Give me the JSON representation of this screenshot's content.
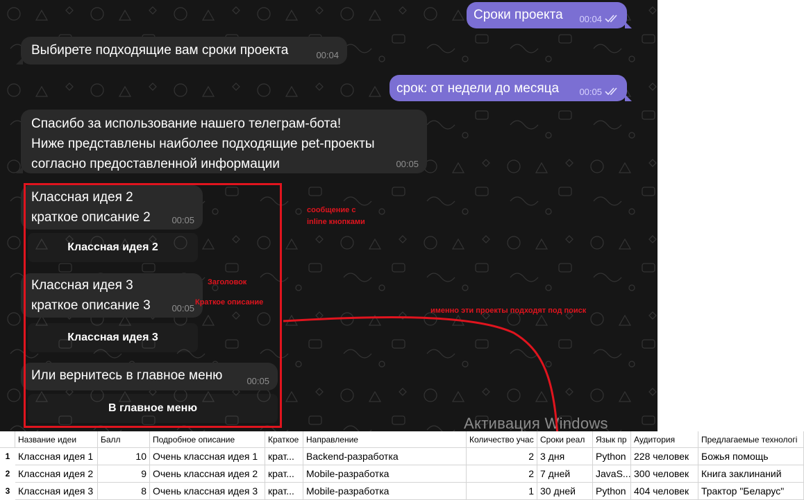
{
  "chat": {
    "messages": {
      "m1": {
        "text": "Сроки проекта",
        "time": "00:04"
      },
      "m2": {
        "text": "Выбирете подходящие вам сроки проекта",
        "time": "00:04"
      },
      "m3": {
        "text": "срок: от недели до месяца",
        "time": "00:05"
      },
      "m4": {
        "line1": "Спасибо за использование нашего телеграм-бота!",
        "line2": "Ниже представлены наиболее подходящие pet-проекты",
        "line3": "согласно предоставленной информации",
        "time": "00:05"
      },
      "m5": {
        "line1": "Классная идея 2",
        "line2": "краткое описание 2",
        "time": "00:05",
        "button": "Классная идея 2"
      },
      "m6": {
        "line1": "Классная идея 3",
        "line2": "краткое описание 3",
        "time": "00:05",
        "button": "Классная идея 3"
      },
      "m7": {
        "text": "Или вернитесь в главное меню",
        "time": "00:05",
        "button": "В главное меню"
      }
    }
  },
  "annotations": {
    "inline_line1": "сообщение с",
    "inline_line2": "inline кнопками",
    "title": "Заголовок",
    "short_desc": "Краткое описание",
    "projects_match": "именно эти проекты подходят под поиск",
    "color": "#e0141e"
  },
  "watermark": "Активация Windows",
  "table": {
    "headers": [
      "Название идеи",
      "Балл",
      "Подробное описание",
      "Краткое",
      "Направление",
      "Количество учас",
      "Сроки реал",
      "Язык пр",
      "Аудитория",
      "Предлагаемые технологі"
    ],
    "rows": [
      {
        "num": "1",
        "cells": [
          "Классная идея 1",
          "10",
          "Очень классная идея 1",
          "крат...",
          "Backend-разработка",
          "2",
          "3 дня",
          "Python",
          "228 человек",
          "Божья помощь"
        ]
      },
      {
        "num": "2",
        "cells": [
          "Классная идея 2",
          "9",
          "Очень классная идея 2",
          "крат...",
          "Mobile-разработка",
          "2",
          "7 дней",
          "JavaS...",
          "300 человек",
          "Книга заклинаний"
        ]
      },
      {
        "num": "3",
        "cells": [
          "Классная идея 3",
          "8",
          "Очень классная идея 3",
          "крат...",
          "Mobile-разработка",
          "1",
          "30 дней",
          "Python",
          "404 человек",
          "Трактор \"Беларус\""
        ]
      }
    ]
  }
}
